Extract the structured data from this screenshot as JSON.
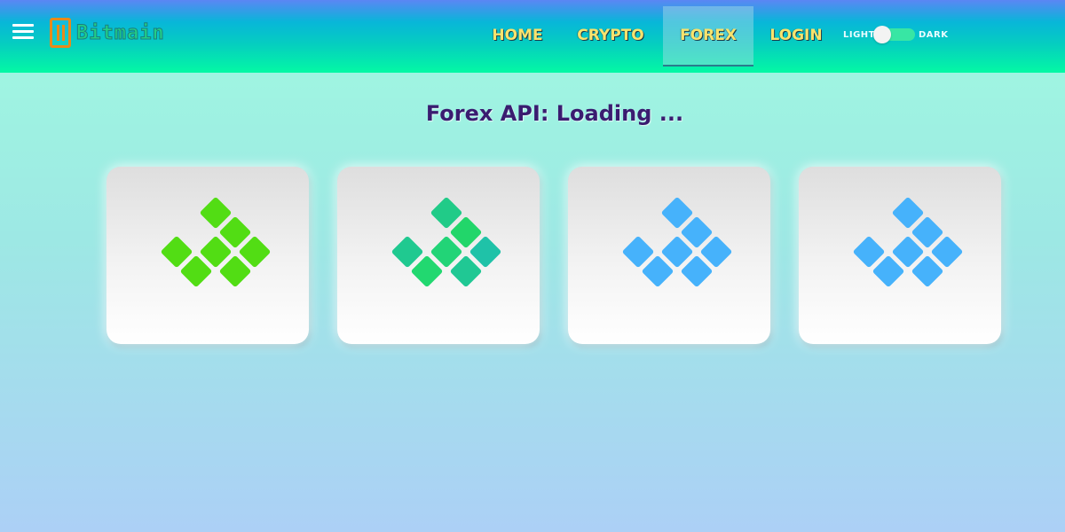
{
  "header": {
    "logo_text": "Bitmain",
    "nav": [
      {
        "label": "HOME",
        "active": false
      },
      {
        "label": "CRYPTO",
        "active": false
      },
      {
        "label": "FOREX",
        "active": true
      },
      {
        "label": "LOGIN",
        "active": false
      }
    ],
    "theme_toggle": {
      "light_label": "LIGHT",
      "dark_label": "DARK",
      "state": "light"
    }
  },
  "main": {
    "title": "Forex API: Loading ...",
    "cards": [
      {
        "loader_colors": [
          "#52dd14",
          "#52dd14",
          "#52dd14",
          "#52dd14",
          "#52dd14",
          "#52dd14",
          "#52dd14"
        ]
      },
      {
        "loader_colors": [
          "#21cb88",
          "#22d66a",
          "#20c990",
          "#22d477",
          "#1fc2a8",
          "#22d870",
          "#20c894"
        ]
      },
      {
        "loader_colors": [
          "#46b2fb",
          "#46b2fb",
          "#46b2fb",
          "#46b2fb",
          "#46b2fb",
          "#46b2fb",
          "#46b2fb"
        ]
      },
      {
        "loader_colors": [
          "#46b2fb",
          "#46b2fb",
          "#46b2fb",
          "#46b2fb",
          "#46b2fb",
          "#46b2fb",
          "#46b2fb"
        ]
      }
    ]
  },
  "colors": {
    "nav_text": "#f8e36d",
    "title_text": "#3a1c70",
    "toggle_track": "#38e6a4"
  }
}
